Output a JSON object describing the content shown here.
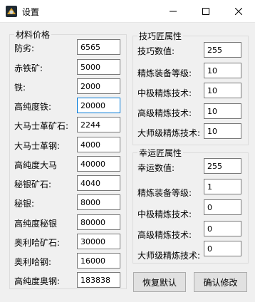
{
  "window": {
    "title": "设置"
  },
  "materials": {
    "label": "材料价格",
    "items": [
      {
        "label": "防劣:",
        "value": "6565"
      },
      {
        "label": "赤铁矿:",
        "value": "5000"
      },
      {
        "label": "铁:",
        "value": "2000"
      },
      {
        "label": "高纯度铁:",
        "value": "20000"
      },
      {
        "label": "大马士革矿石:",
        "value": "2244"
      },
      {
        "label": "大马士革钢:",
        "value": "4000"
      },
      {
        "label": "高纯度大马",
        "value": "40000"
      },
      {
        "label": "秘银矿石:",
        "value": "4040"
      },
      {
        "label": "秘银:",
        "value": "8000"
      },
      {
        "label": "高纯度秘银",
        "value": "80000"
      },
      {
        "label": "奥利哈矿石:",
        "value": "30000"
      },
      {
        "label": "奥利哈钢:",
        "value": "16000"
      },
      {
        "label": "高纯度奥钢:",
        "value": "183838"
      }
    ]
  },
  "skill": {
    "label": "技巧匠属性",
    "items": [
      {
        "label": "技巧数值:",
        "value": "255"
      },
      {
        "label": "精炼装备等级:",
        "value": "10"
      },
      {
        "label": "中极精炼技术:",
        "value": "10"
      },
      {
        "label": "高级精炼技术:",
        "value": "10"
      },
      {
        "label": "大师级精炼技术:",
        "value": "10"
      }
    ]
  },
  "luck": {
    "label": "幸运匠属性",
    "items": [
      {
        "label": "幸运数值:",
        "value": "255"
      },
      {
        "label": "精炼装备等级:",
        "value": "1"
      },
      {
        "label": "中极精炼技术:",
        "value": "0"
      },
      {
        "label": "高级精炼技术:",
        "value": "0"
      },
      {
        "label": "大师级精炼技术:",
        "value": "0"
      }
    ]
  },
  "buttons": {
    "restore": "恢复默认",
    "confirm": "确认修改"
  }
}
